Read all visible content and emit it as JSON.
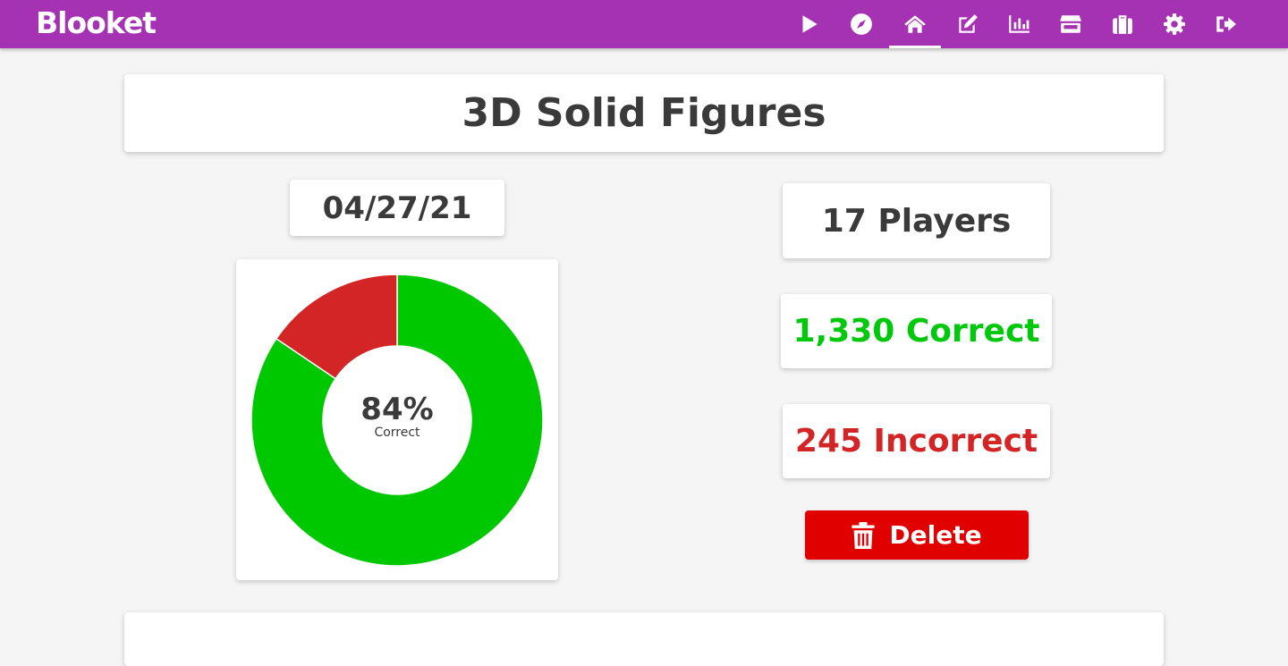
{
  "app": {
    "logo": "Blooket"
  },
  "nav": {
    "items": [
      {
        "name": "play",
        "icon": "play-icon"
      },
      {
        "name": "discover",
        "icon": "compass-icon"
      },
      {
        "name": "home",
        "icon": "home-icon",
        "active": true
      },
      {
        "name": "create",
        "icon": "edit-icon"
      },
      {
        "name": "stats",
        "icon": "bar-chart-icon"
      },
      {
        "name": "market",
        "icon": "store-icon"
      },
      {
        "name": "blooks",
        "icon": "briefcase-icon"
      },
      {
        "name": "settings",
        "icon": "gear-icon"
      },
      {
        "name": "logout",
        "icon": "sign-out-icon"
      }
    ],
    "color": "#a531b3"
  },
  "game": {
    "title": "3D Solid Figures",
    "date": "04/27/21",
    "players": "17 Players",
    "correct": "1,330 Correct",
    "incorrect": "245 Incorrect",
    "delete_label": "Delete"
  },
  "chart_data": {
    "type": "pie",
    "categories": [
      "Correct",
      "Incorrect"
    ],
    "values": [
      1330,
      245
    ],
    "colors": [
      "#00c800",
      "#d32525"
    ],
    "center_value": "84%",
    "center_label": "Correct"
  },
  "colors": {
    "correct": "#00c80a",
    "incorrect": "#d32525",
    "delete": "#e00000"
  }
}
